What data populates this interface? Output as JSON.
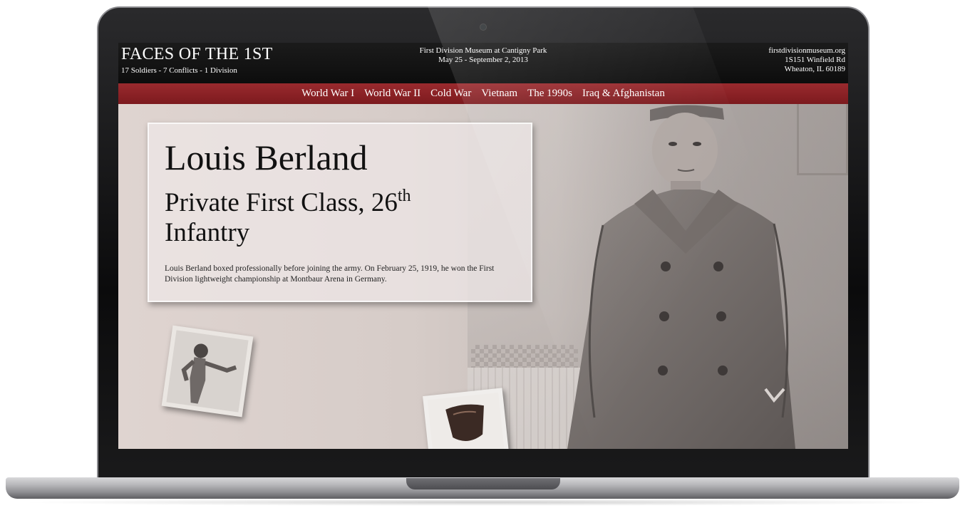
{
  "site": {
    "title": "FACES OF THE 1ST",
    "tagline": "17 Soldiers - 7 Conflicts - 1 Division",
    "venue": "First Division Museum at Cantigny Park",
    "dates": "May 25 - September 2, 2013",
    "url": "firstdivisionmuseum.org",
    "address1": "1S151 Winfield Rd",
    "address2": "Wheaton, IL 60189"
  },
  "nav": {
    "items": [
      {
        "label": "World War I"
      },
      {
        "label": "World War II"
      },
      {
        "label": "Cold War"
      },
      {
        "label": "Vietnam"
      },
      {
        "label": "The 1990s"
      },
      {
        "label": "Iraq & Afghanistan"
      }
    ]
  },
  "feature": {
    "name": "Louis Berland",
    "rank_prefix": "Private First Class, 26",
    "rank_sup": "th",
    "rank_suffix": "Infantry",
    "bio": "Louis Berland boxed professionally before joining the army. On February 25, 1919, he won the First Division lightweight championship at Montbaur Arena in Germany."
  },
  "colors": {
    "nav_red": "#8c2226",
    "header_black": "#111111"
  }
}
